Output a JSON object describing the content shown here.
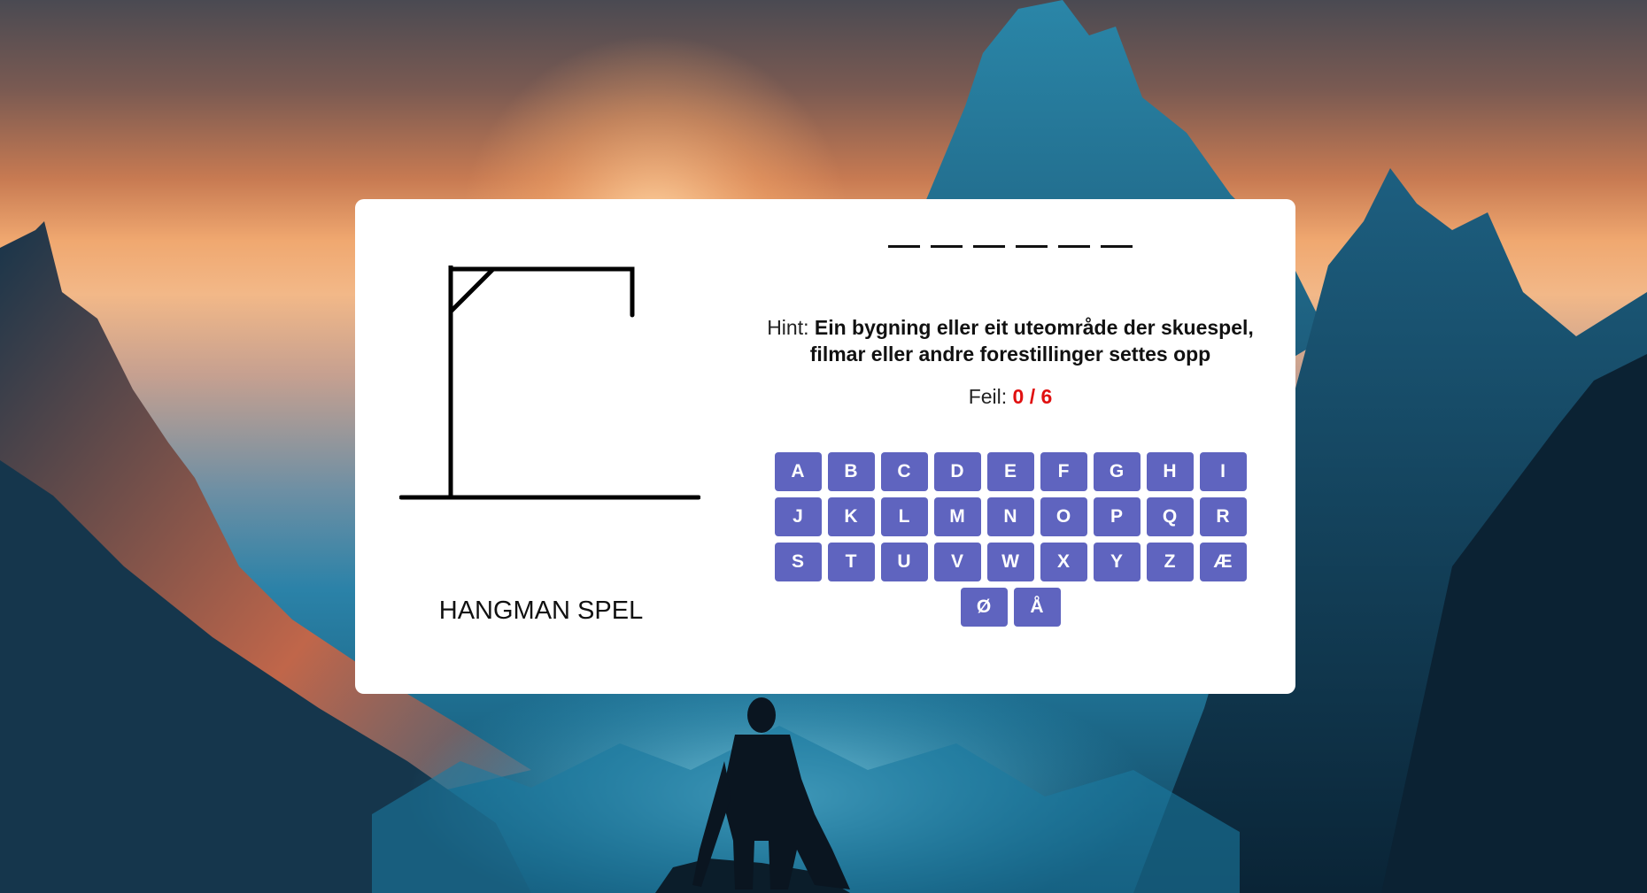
{
  "game": {
    "title": "HANGMAN SPEL",
    "word_slots": 6,
    "hint_label": "Hint:",
    "hint_text": "Ein bygning eller eit uteområde der skuespel, filmar eller andre forestillinger settes opp",
    "errors_label": "Feil:",
    "errors_count": "0 / 6"
  },
  "keyboard": {
    "rows": [
      [
        "A",
        "B",
        "C",
        "D",
        "E",
        "F",
        "G",
        "H",
        "I"
      ],
      [
        "J",
        "K",
        "L",
        "M",
        "N",
        "O",
        "P",
        "Q",
        "R"
      ],
      [
        "S",
        "T",
        "U",
        "V",
        "W",
        "X",
        "Y",
        "Z",
        "Æ"
      ],
      [
        "Ø",
        "Å"
      ]
    ]
  },
  "colors": {
    "key_background": "#5f64bf",
    "error_count": "#e01010",
    "card": "#ffffff"
  }
}
